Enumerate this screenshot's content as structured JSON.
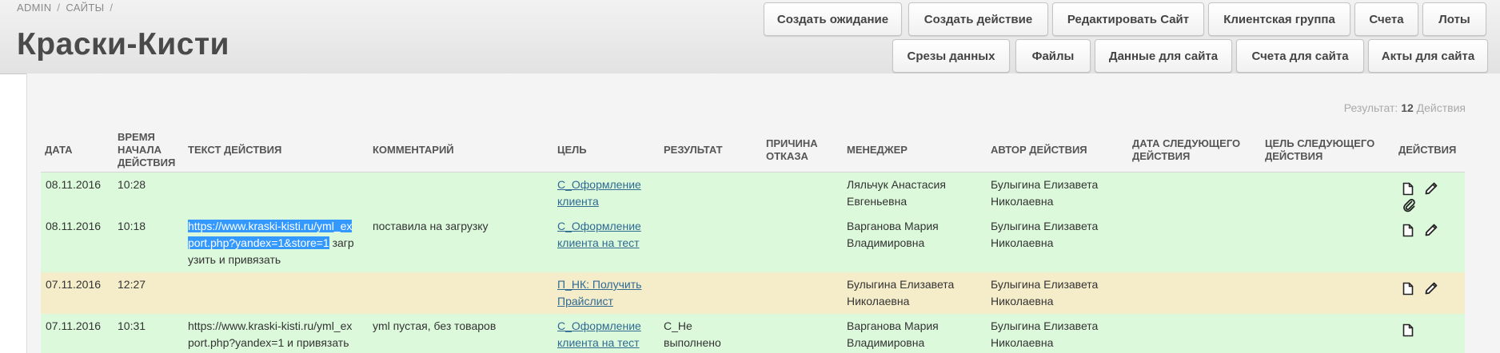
{
  "breadcrumb": {
    "items": [
      "ADMIN",
      "САЙТЫ"
    ],
    "separator": "/"
  },
  "page": {
    "title": "Краски-Кисти"
  },
  "toolbar": {
    "row1": [
      "Создать ожидание",
      "Создать действие",
      "Редактировать Сайт",
      "Клиентская группа",
      "Счета",
      "Лоты"
    ],
    "row2": [
      "Срезы данных",
      "Файлы",
      "Данные для сайта",
      "Счета для сайта",
      "Акты для сайта"
    ]
  },
  "result": {
    "label": "Результат:",
    "count": "12",
    "unit": "Действия"
  },
  "columns": {
    "date": "ДАТА",
    "start_time": [
      "ВРЕМЯ",
      "НАЧАЛА",
      "ДЕЙСТВИЯ"
    ],
    "text": "ТЕКСТ ДЕЙСТВИЯ",
    "comment": "КОММЕНТАРИЙ",
    "goal": "ЦЕЛЬ",
    "result": "РЕЗУЛЬТАТ",
    "reason": [
      "ПРИЧИНА",
      "ОТКАЗА"
    ],
    "manager": "МЕНЕДЖЕР",
    "author": "АВТОР ДЕЙСТВИЯ",
    "next_date": [
      "ДАТА СЛЕДУЮЩЕГО",
      "ДЕЙСТВИЯ"
    ],
    "next_goal": [
      "ЦЕЛЬ СЛЕДУЮЩЕГО",
      "ДЕЙСТВИЯ"
    ],
    "actions": "ДЕЙСТВИЯ"
  },
  "rows": [
    {
      "date": "08.11.2016",
      "time": "10:28",
      "goal": [
        "С_Оформление",
        "клиента"
      ],
      "manager": [
        "Ляльчук Анастасия",
        "Евгеньевна"
      ],
      "author": [
        "Булыгина Елизавета",
        "Николаевна"
      ]
    },
    {
      "date": "08.11.2016",
      "time": "10:18",
      "text": {
        "selected": [
          "https://www.kraski-kisti.ru/yml_ex",
          "port.php?yandex=1&store=1"
        ],
        "rest": " загр",
        "line3": "узить и привязать"
      },
      "comment": "поставила на загрузку",
      "goal": [
        "С_Оформление",
        "клиента на тест"
      ],
      "manager": [
        "Варганова Мария",
        "Владимировна"
      ],
      "author": [
        "Булыгина Елизавета",
        "Николаевна"
      ]
    },
    {
      "date": "07.11.2016",
      "time": "12:27",
      "goal": [
        "П_НК: Получить",
        "Прайслист"
      ],
      "manager": [
        "Булыгина Елизавета",
        "Николаевна"
      ],
      "author": [
        "Булыгина Елизавета",
        "Николаевна"
      ]
    },
    {
      "date": "07.11.2016",
      "time": "10:31",
      "text": [
        "https://www.kraski-kisti.ru/yml_ex",
        "port.php?yandex=1 и привязать"
      ],
      "comment": "yml пустая, без товаров",
      "goal": [
        "С_Оформление",
        "клиента на тест"
      ],
      "result": [
        "С_Не",
        "выполнено"
      ],
      "manager": [
        "Варганова Мария",
        "Владимировна"
      ],
      "author": [
        "Булыгина Елизавета",
        "Николаевна"
      ]
    }
  ],
  "colors": {
    "row_green": "#dcf9dc",
    "row_yellow": "#f5ecca",
    "link": "#2f6a92",
    "selection": "#3399ff"
  },
  "icons": {
    "view": "document-icon",
    "edit": "pencil-icon",
    "attach": "paperclip-icon"
  }
}
